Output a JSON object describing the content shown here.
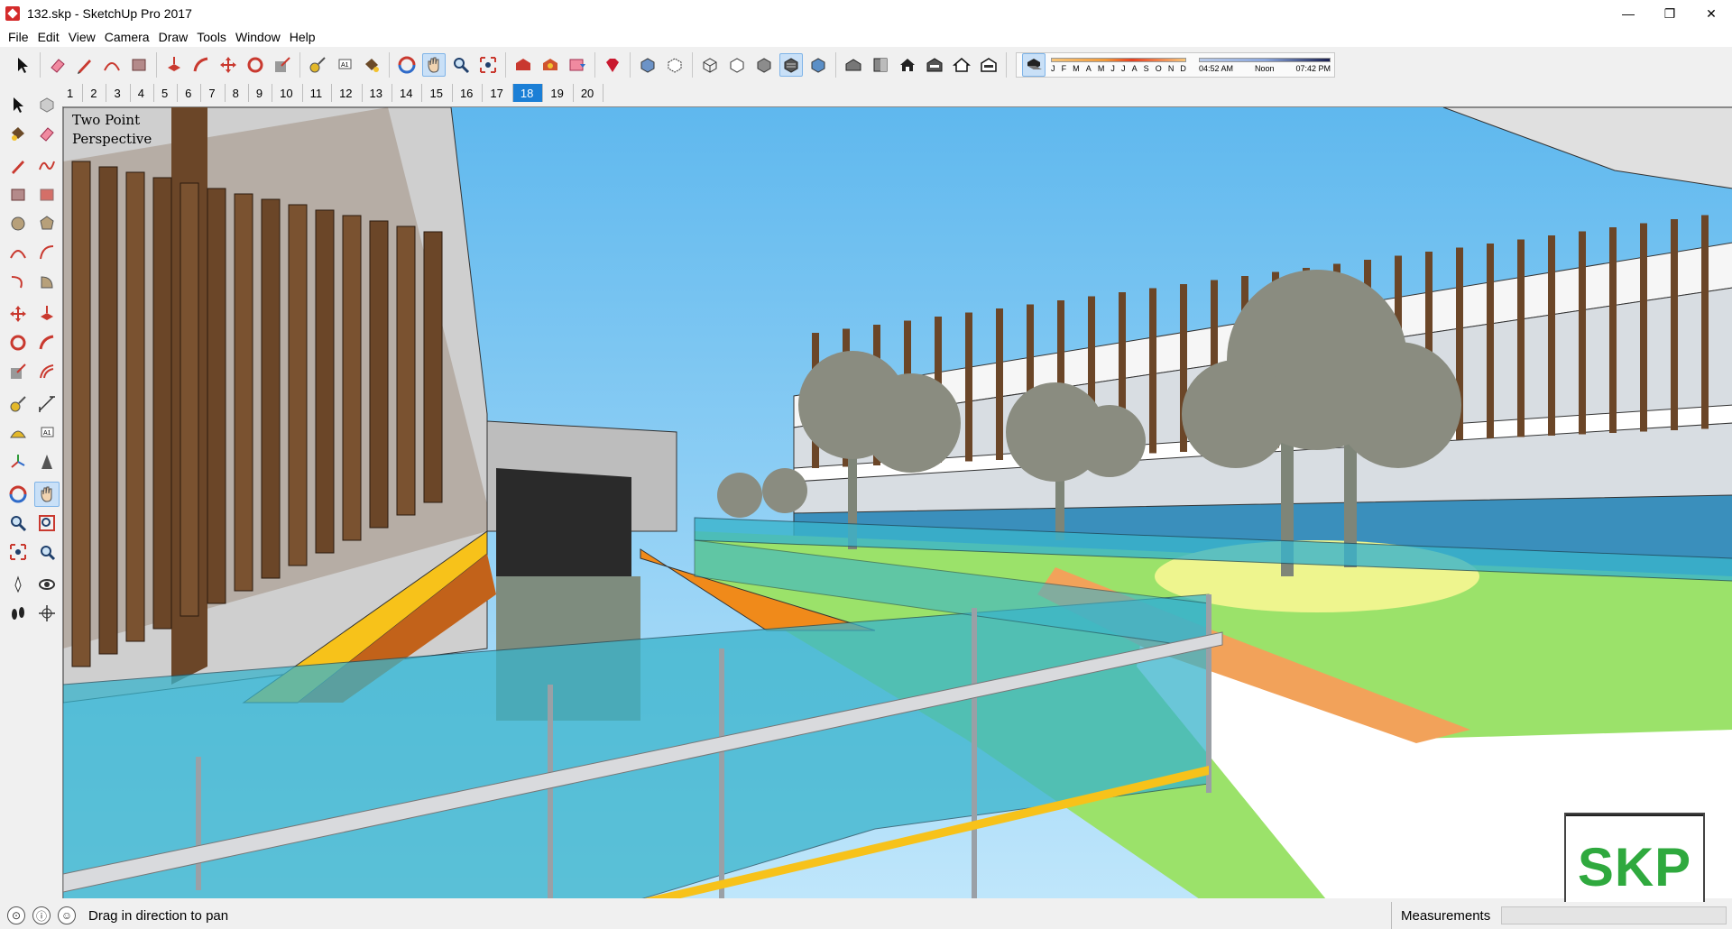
{
  "window": {
    "title": "132.skp - SketchUp Pro 2017",
    "minimize": "—",
    "maximize": "❐",
    "close": "✕"
  },
  "menu": [
    "File",
    "Edit",
    "View",
    "Camera",
    "Draw",
    "Tools",
    "Window",
    "Help"
  ],
  "shadow_settings": {
    "months": [
      "J",
      "F",
      "M",
      "A",
      "M",
      "J",
      "J",
      "A",
      "S",
      "O",
      "N",
      "D"
    ],
    "time_start": "04:52 AM",
    "time_mid": "Noon",
    "time_end": "07:42 PM"
  },
  "scenes": {
    "tabs": [
      "1",
      "2",
      "3",
      "4",
      "5",
      "6",
      "7",
      "8",
      "9",
      "10",
      "11",
      "12",
      "13",
      "14",
      "15",
      "16",
      "17",
      "18",
      "19",
      "20"
    ],
    "active": "18"
  },
  "viewport": {
    "camera_label_1": "Two Point",
    "camera_label_2": "Perspective"
  },
  "badge": {
    "text": "SKP"
  },
  "status": {
    "hint": "Drag in direction to pan",
    "measurements_label": "Measurements",
    "measurements_value": ""
  },
  "colors": {
    "sky": "#7cc8f2",
    "glass": "#39b4cc",
    "grass": "#9be26a",
    "wood": "#6b4628",
    "active_scene": "#1b7fd6",
    "badge_text": "#2fa93e"
  },
  "toolbar_icons": [
    "select-icon",
    "eraser-icon",
    "pencil-icon",
    "arc-icon",
    "rectangle-icon",
    "push-pull-icon",
    "follow-me-icon",
    "move-icon",
    "rotate-icon",
    "scale-icon",
    "tape-measure-icon",
    "text-icon",
    "paint-bucket-icon",
    "orbit-icon",
    "pan-icon",
    "zoom-icon",
    "zoom-extents-icon",
    "3d-warehouse-icon",
    "extension-warehouse-icon",
    "layout-icon",
    "ruby-icon",
    "xray-icon",
    "back-edges-icon",
    "wireframe-icon",
    "hidden-line-icon",
    "shaded-icon",
    "shaded-textures-icon",
    "monochrome-icon",
    "iso-view-icon",
    "top-view-icon",
    "front-view-icon",
    "right-view-icon",
    "back-view-icon",
    "left-view-icon",
    "shadows-toggle-icon"
  ]
}
